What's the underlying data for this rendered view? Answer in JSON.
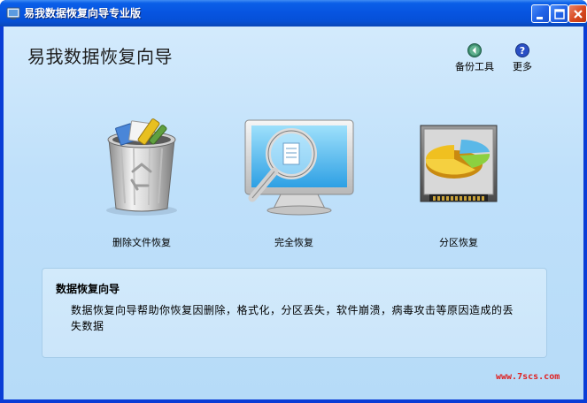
{
  "window": {
    "title": "易我数据恢复向导专业版"
  },
  "header": {
    "app_title": "易我数据恢复向导",
    "tools": [
      {
        "label": "备份工具",
        "icon": "backup-arrow-icon"
      },
      {
        "label": "更多",
        "icon": "help-icon"
      }
    ]
  },
  "features": [
    {
      "label": "删除文件恢复",
      "icon": "recycle-bin-icon"
    },
    {
      "label": "完全恢复",
      "icon": "monitor-magnifier-icon"
    },
    {
      "label": "分区恢复",
      "icon": "hard-drive-pie-icon"
    }
  ],
  "description": {
    "title": "数据恢复向导",
    "text": "数据恢复向导帮助你恢复因删除，格式化，分区丢失，软件崩溃，病毒攻击等原因造成的丢失数据"
  },
  "watermark": "www.7scs.com",
  "colors": {
    "titlebar": "#0754e0",
    "client_background": "#c2e1fb",
    "watermark": "#e02020"
  }
}
